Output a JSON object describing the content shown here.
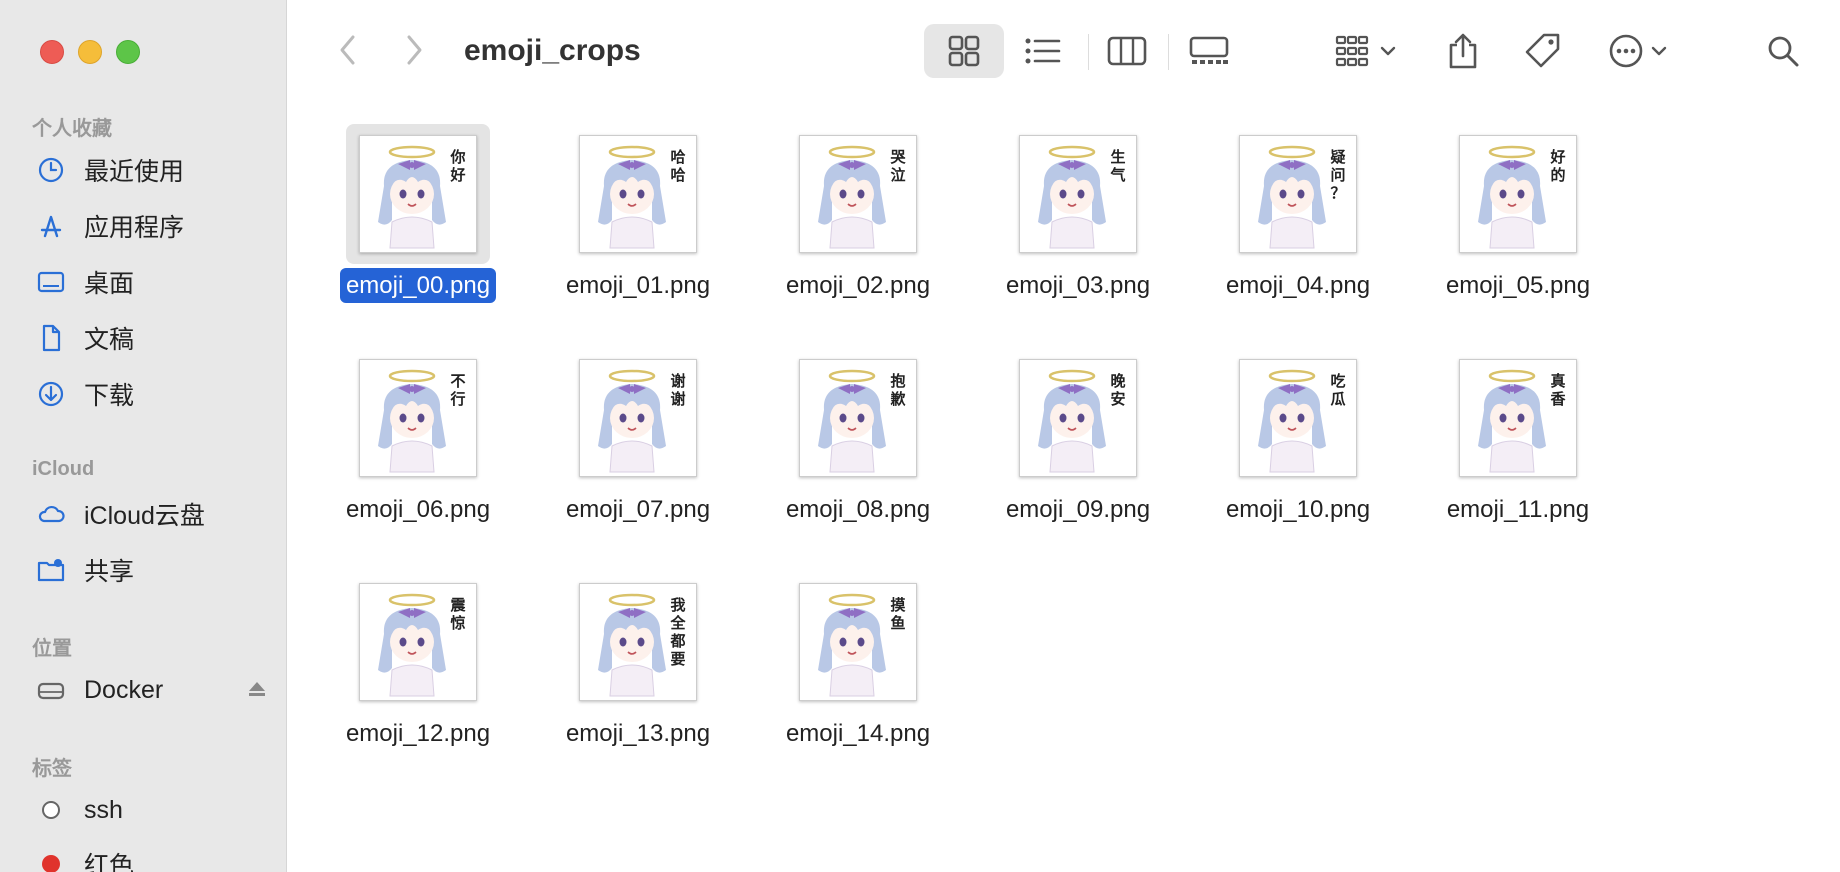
{
  "window": {
    "title": "emoji_crops"
  },
  "sidebar": {
    "favorites_header": "个人收藏",
    "favorites": [
      {
        "label": "最近使用",
        "icon": "clock-icon"
      },
      {
        "label": "应用程序",
        "icon": "applications-icon"
      },
      {
        "label": "桌面",
        "icon": "desktop-icon"
      },
      {
        "label": "文稿",
        "icon": "document-icon"
      },
      {
        "label": "下载",
        "icon": "download-icon"
      }
    ],
    "icloud_header": "iCloud",
    "icloud": [
      {
        "label": "iCloud云盘",
        "icon": "cloud-icon"
      },
      {
        "label": "共享",
        "icon": "shared-folder-icon"
      }
    ],
    "locations_header": "位置",
    "locations": [
      {
        "label": "Docker",
        "icon": "drive-icon"
      }
    ],
    "tags_header": "标签",
    "tags": [
      {
        "label": "ssh",
        "color": "#ffffff"
      },
      {
        "label": "红色",
        "color": "#e0332c"
      }
    ]
  },
  "toolbar": {
    "view_modes": [
      "icon-view",
      "list-view",
      "column-view",
      "gallery-view"
    ],
    "active_view": "icon-view"
  },
  "files": [
    {
      "name": "emoji_00.png",
      "caption": "你好",
      "selected": true
    },
    {
      "name": "emoji_01.png",
      "caption": "哈哈",
      "selected": false
    },
    {
      "name": "emoji_02.png",
      "caption": "哭泣",
      "selected": false
    },
    {
      "name": "emoji_03.png",
      "caption": "生气",
      "selected": false
    },
    {
      "name": "emoji_04.png",
      "caption": "疑问？",
      "selected": false
    },
    {
      "name": "emoji_05.png",
      "caption": "好的",
      "selected": false
    },
    {
      "name": "emoji_06.png",
      "caption": "不行",
      "selected": false
    },
    {
      "name": "emoji_07.png",
      "caption": "谢谢",
      "selected": false
    },
    {
      "name": "emoji_08.png",
      "caption": "抱歉",
      "selected": false
    },
    {
      "name": "emoji_09.png",
      "caption": "晚安",
      "selected": false
    },
    {
      "name": "emoji_10.png",
      "caption": "吃瓜",
      "selected": false
    },
    {
      "name": "emoji_11.png",
      "caption": "真香",
      "selected": false
    },
    {
      "name": "emoji_12.png",
      "caption": "震惊",
      "selected": false
    },
    {
      "name": "emoji_13.png",
      "caption": "我全都要",
      "selected": false
    },
    {
      "name": "emoji_14.png",
      "caption": "摸鱼",
      "selected": false
    }
  ],
  "colors": {
    "selection": "#2563d6",
    "accent": "#2a6fd6",
    "hair": "#b9c8e6",
    "bow": "#8f6fc4",
    "halo": "#d9c26a"
  }
}
